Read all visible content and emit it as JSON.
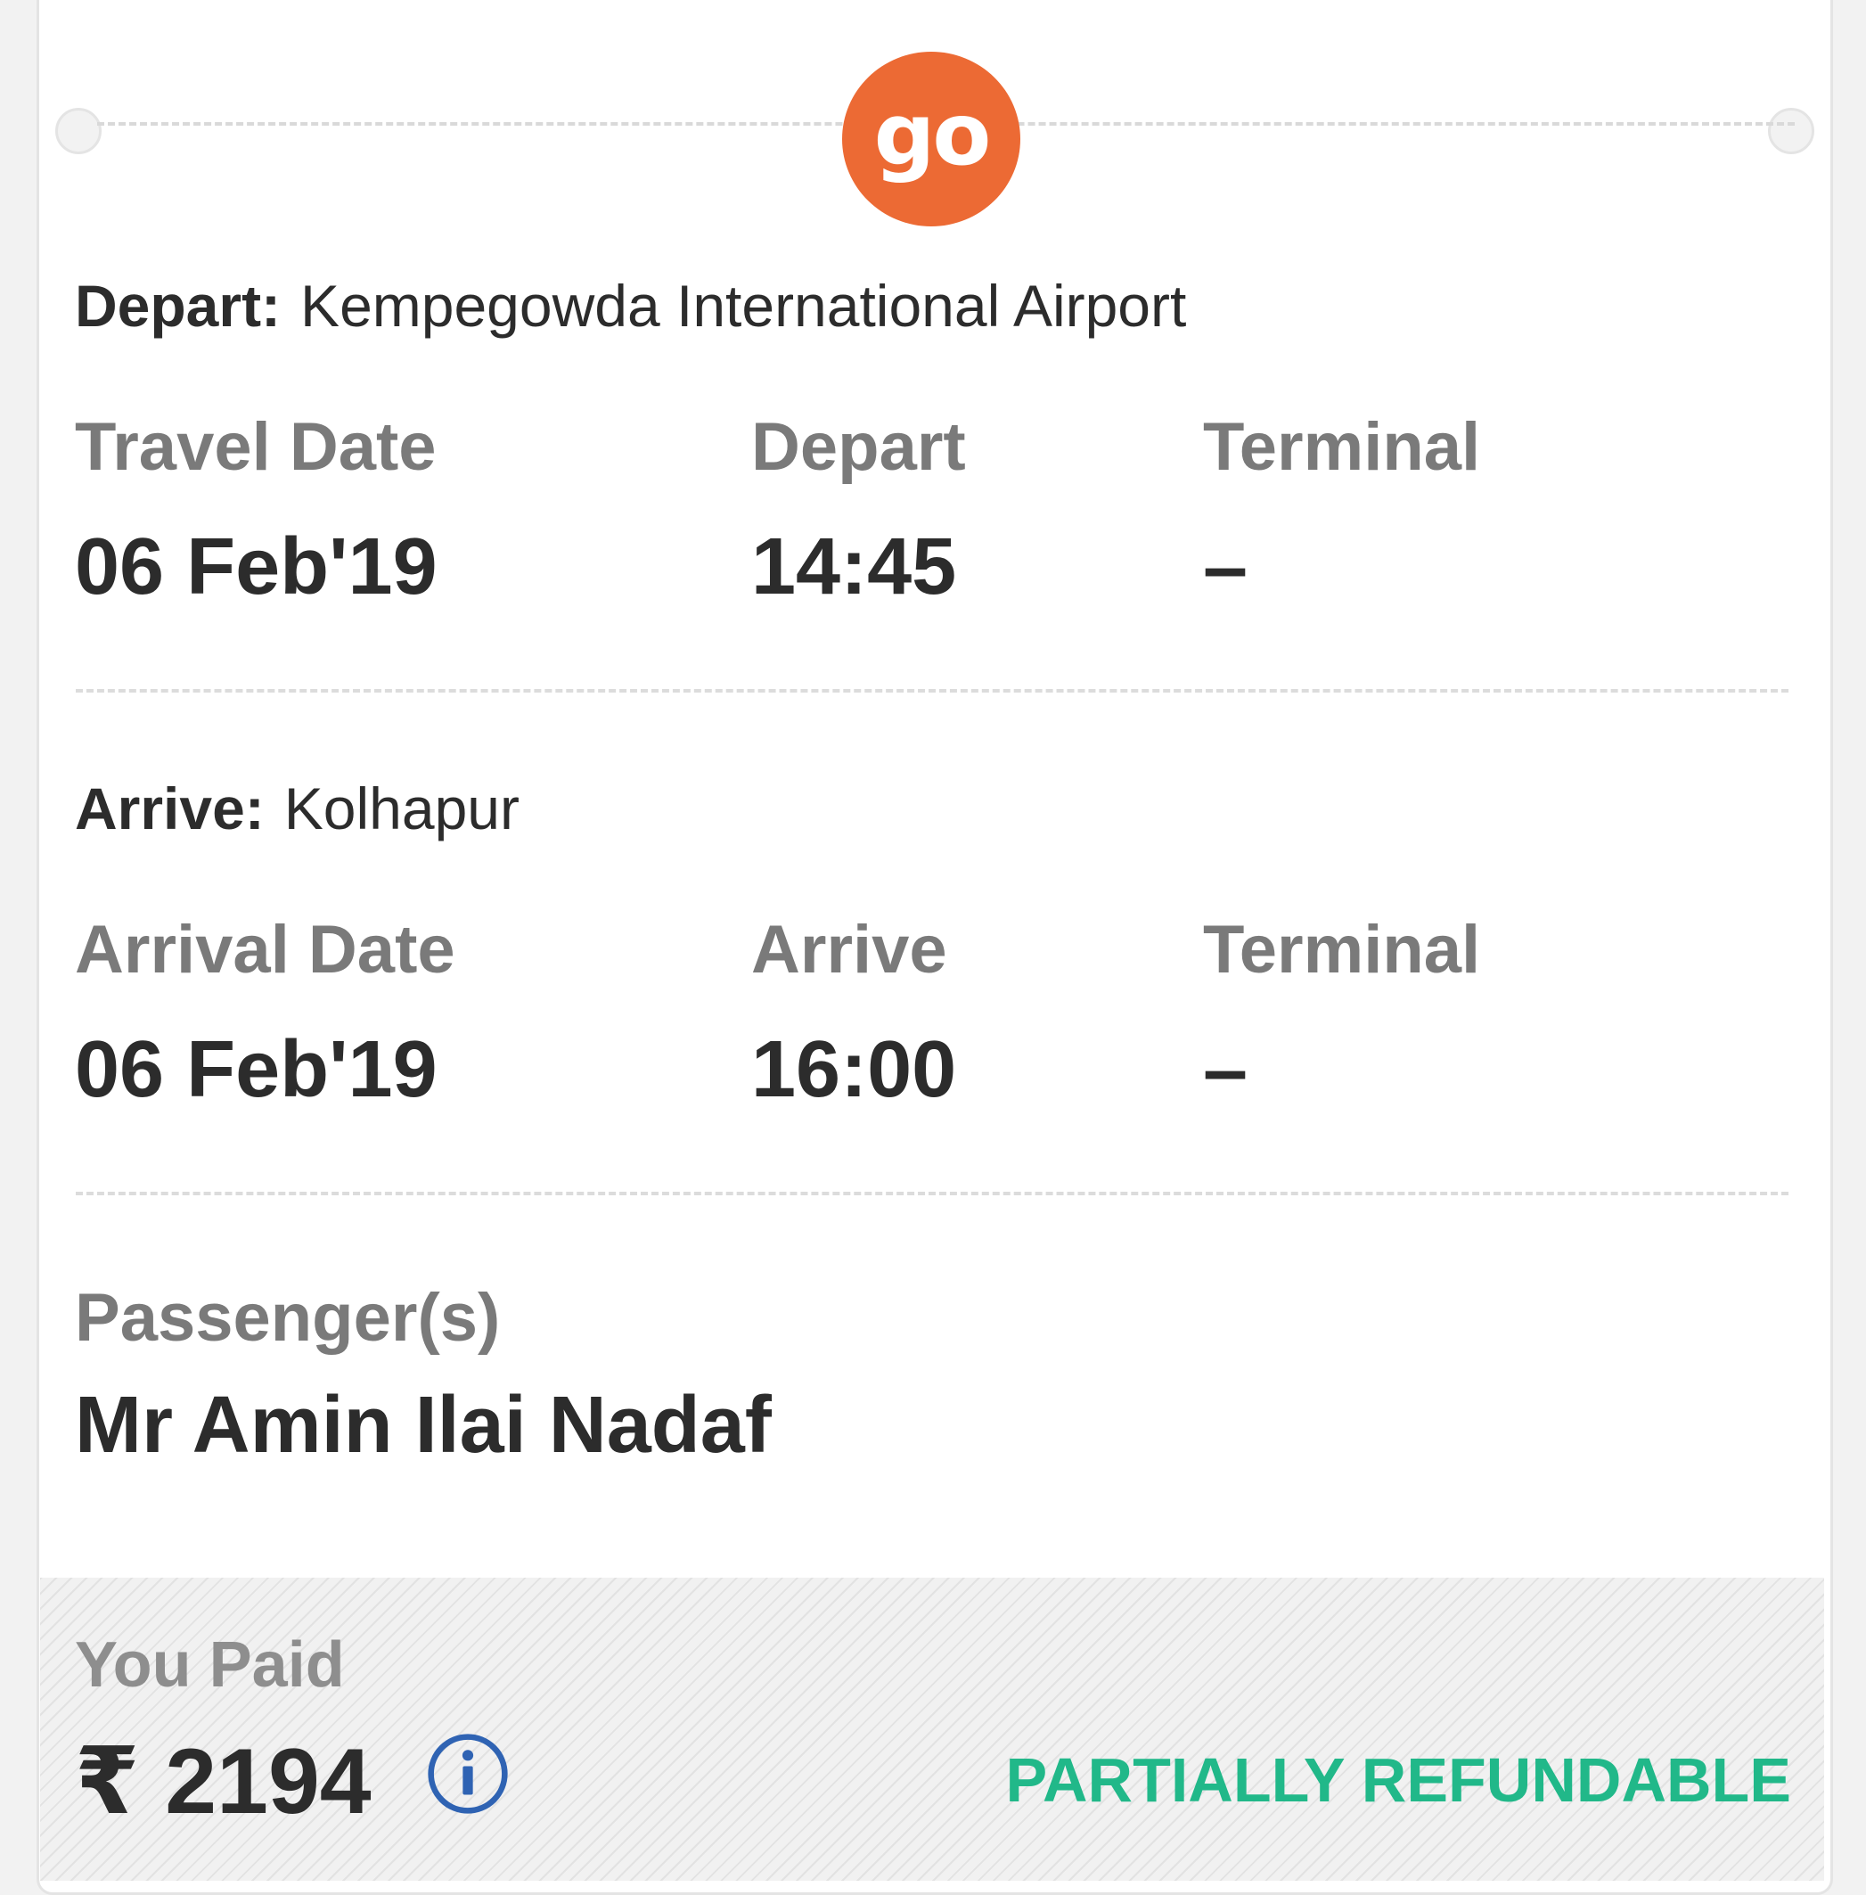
{
  "brand": {
    "logo_text": "go",
    "logo_color": "#ec6a34"
  },
  "departure": {
    "label": "Depart:",
    "airport": "Kempegowda International Airport",
    "date_label": "Travel Date",
    "date": "06 Feb'19",
    "time_label": "Depart",
    "time": "14:45",
    "terminal_label": "Terminal",
    "terminal": "–"
  },
  "arrival": {
    "label": "Arrive:",
    "airport": "Kolhapur",
    "date_label": "Arrival Date",
    "date": "06 Feb'19",
    "time_label": "Arrive",
    "time": "16:00",
    "terminal_label": "Terminal",
    "terminal": "–"
  },
  "passengers": {
    "label": "Passenger(s)",
    "names": [
      "Mr Amin Ilai Nadaf"
    ]
  },
  "payment": {
    "label": "You Paid",
    "currency_symbol": "₹",
    "amount": "2194",
    "refund_status": "PARTIALLY REFUNDABLE",
    "refund_color": "#21b889",
    "info_icon": "info-icon"
  }
}
